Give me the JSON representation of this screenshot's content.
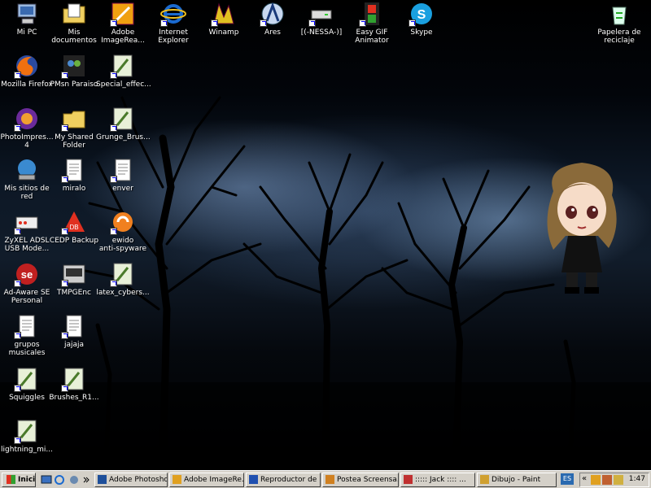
{
  "desktop": {
    "icons": [
      {
        "name": "mi-pc-icon",
        "label": "Mi PC",
        "kind": "computer-icon"
      },
      {
        "name": "mis-documentos-icon",
        "label": "Mis\ndocumentos",
        "kind": "folder-doc-icon"
      },
      {
        "name": "adobe-imageready-icon",
        "label": "Adobe\nImageRea...",
        "kind": "imageready-icon"
      },
      {
        "name": "internet-explorer-icon",
        "label": "Internet\nExplorer",
        "kind": "ie-icon"
      },
      {
        "name": "winamp-icon",
        "label": "Winamp",
        "kind": "winamp-icon"
      },
      {
        "name": "ares-icon",
        "label": "Ares",
        "kind": "ares-icon"
      },
      {
        "name": "nessa-drive-icon",
        "label": "[(-NESSA-)]",
        "kind": "drive-icon"
      },
      {
        "name": "easy-gif-animator-icon",
        "label": "Easy GIF\nAnimator",
        "kind": "film-icon"
      },
      {
        "name": "skype-icon",
        "label": "Skype",
        "kind": "skype-icon"
      },
      {
        "name": "papelera-icon",
        "label": "Papelera de\nreciclaje",
        "kind": "recycle-icon"
      },
      {
        "name": "mozilla-firefox-icon",
        "label": "Mozilla Firefox",
        "kind": "firefox-icon"
      },
      {
        "name": "pmsn-paraiso-icon",
        "label": "PMsn Paraiso",
        "kind": "msn-icon"
      },
      {
        "name": "special-effects-icon",
        "label": "Special_effec...",
        "kind": "brush-file-icon"
      },
      {
        "name": "photoimpression-icon",
        "label": "PhotoImpres...\n4",
        "kind": "photo-icon"
      },
      {
        "name": "my-shared-folder-icon",
        "label": "My Shared\nFolder",
        "kind": "folder-icon"
      },
      {
        "name": "grunge-brushes-icon",
        "label": "Grunge_Brus...",
        "kind": "brush-file-icon"
      },
      {
        "name": "mis-sitios-de-red-icon",
        "label": "Mis sitios de\nred",
        "kind": "network-icon"
      },
      {
        "name": "miralo-icon",
        "label": "miralo",
        "kind": "text-file-icon"
      },
      {
        "name": "enver-icon",
        "label": "enver",
        "kind": "text-file-icon"
      },
      {
        "name": "zyxel-adsl-icon",
        "label": "ZyXEL ADSL\nUSB Mode...",
        "kind": "modem-icon"
      },
      {
        "name": "cedp-backup-icon",
        "label": "CEDP Backup",
        "kind": "backup-icon"
      },
      {
        "name": "ewido-icon",
        "label": "ewido\nanti-spyware",
        "kind": "ewido-icon"
      },
      {
        "name": "ad-aware-icon",
        "label": "Ad-Aware SE\nPersonal",
        "kind": "adaware-icon"
      },
      {
        "name": "tmpgenc-icon",
        "label": "TMPGEnc",
        "kind": "tmpgenc-icon"
      },
      {
        "name": "latex-cyber-icon",
        "label": "latex_cybers...",
        "kind": "brush-file-icon"
      },
      {
        "name": "grupos-musicales-icon",
        "label": "grupos\nmusicales",
        "kind": "text-file-icon"
      },
      {
        "name": "jajaja-icon",
        "label": "jajaja",
        "kind": "text-file-icon"
      },
      {
        "name": "squiggles-icon",
        "label": "Squiggles",
        "kind": "brush-file-icon"
      },
      {
        "name": "brushes-r1-icon",
        "label": "Brushes_R1...",
        "kind": "brush-file-icon"
      },
      {
        "name": "lightning-icon",
        "label": "lightning_mi...",
        "kind": "brush-file-icon"
      }
    ]
  },
  "taskbar": {
    "start_label": "Inicio",
    "tasks": [
      {
        "label": "Adobe Photoshop",
        "color": "#1e4f9a"
      },
      {
        "label": "Adobe ImageRe...",
        "color": "#e0a020"
      },
      {
        "label": "Reproductor de ...",
        "color": "#2050b0"
      },
      {
        "label": "Postea Screensa...",
        "color": "#d08020"
      },
      {
        "label": "::::: Jack :::: ...",
        "color": "#c03030"
      },
      {
        "label": "Dibujo - Paint",
        "color": "#d0a030"
      }
    ],
    "lang": "ES",
    "tray_chevron": "«",
    "clock": "1:47"
  }
}
